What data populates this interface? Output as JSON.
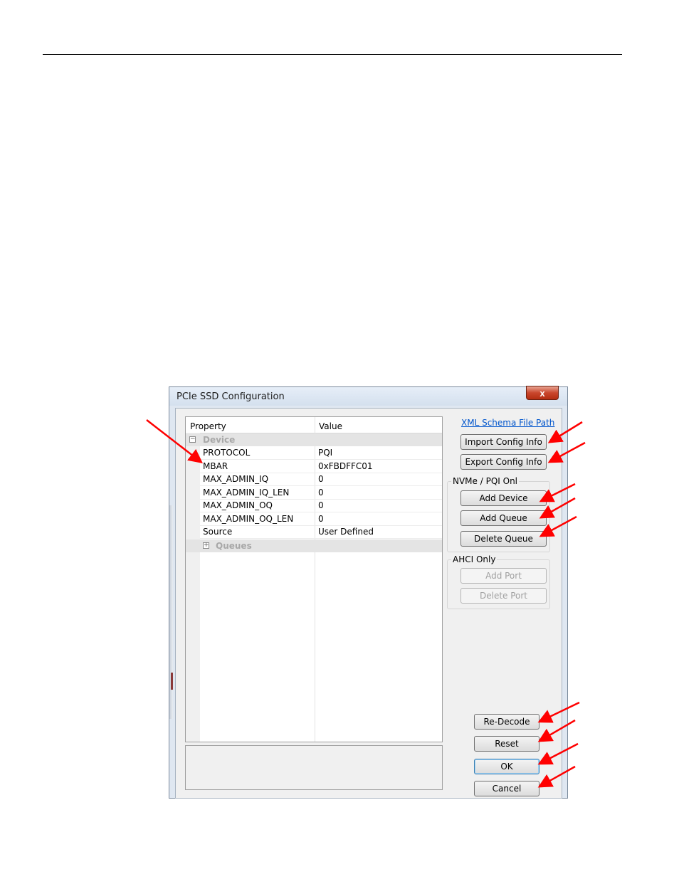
{
  "window": {
    "title": "PCIe SSD Configuration",
    "close_label": "x"
  },
  "grid": {
    "headers": {
      "property": "Property",
      "value": "Value"
    },
    "categories": {
      "device": {
        "label": "Device",
        "expander": "−"
      },
      "queues": {
        "label": "Queues",
        "expander": "+"
      }
    },
    "rows": [
      {
        "name": "PROTOCOL",
        "value": "PQI"
      },
      {
        "name": "MBAR",
        "value": "0xFBDFFC01"
      },
      {
        "name": "MAX_ADMIN_IQ",
        "value": "0"
      },
      {
        "name": "MAX_ADMIN_IQ_LEN",
        "value": "0"
      },
      {
        "name": "MAX_ADMIN_OQ",
        "value": "0"
      },
      {
        "name": "MAX_ADMIN_OQ_LEN",
        "value": "0"
      },
      {
        "name": "Source",
        "value": "User Defined"
      }
    ]
  },
  "right_panel": {
    "schema_link": "XML Schema File Path",
    "import_label": "Import Config Info",
    "export_label": "Export Config Info",
    "nvme_group": {
      "label": "NVMe / PQI Onl",
      "add_device": "Add Device",
      "add_queue": "Add Queue",
      "delete_queue": "Delete Queue"
    },
    "ahci_group": {
      "label": "AHCI Only",
      "add_port": "Add Port",
      "delete_port": "Delete Port"
    },
    "redecode_label": "Re-Decode",
    "reset_label": "Reset",
    "ok_label": "OK",
    "cancel_label": "Cancel"
  },
  "colors": {
    "annotation_arrow": "#ff0000",
    "link": "#0055cc"
  }
}
